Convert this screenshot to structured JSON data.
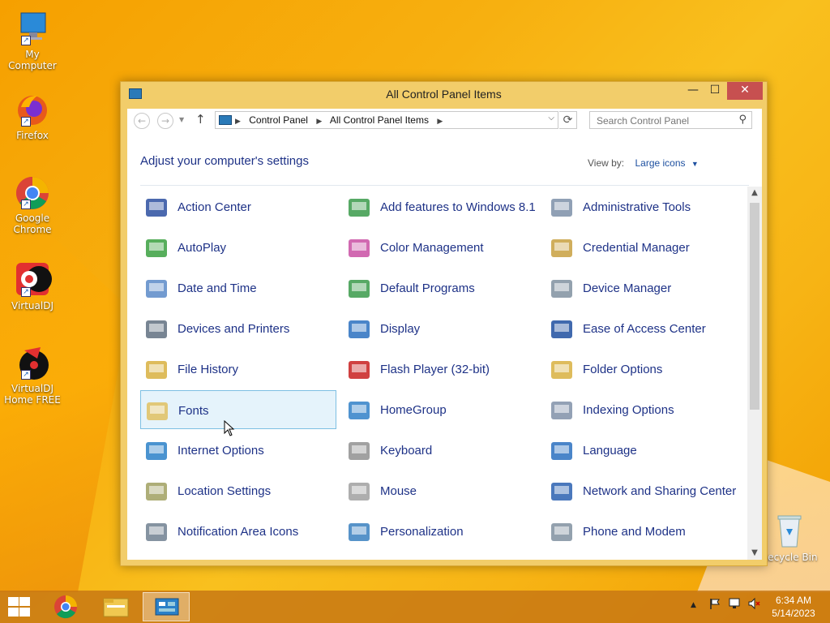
{
  "desktop": {
    "icons": [
      {
        "label": "My Computer",
        "name": "my-computer-icon"
      },
      {
        "label": "Firefox",
        "name": "firefox-icon"
      },
      {
        "label": "Google Chrome",
        "name": "chrome-icon"
      },
      {
        "label": "VirtualDJ",
        "name": "virtualdj-icon"
      },
      {
        "label": "VirtualDJ Home FREE",
        "name": "virtualdj-home-icon"
      },
      {
        "label": "Recycle Bin",
        "name": "recycle-bin-icon"
      }
    ]
  },
  "window": {
    "title": "All Control Panel Items",
    "minimize_glyph": "—",
    "maximize_glyph": "☐",
    "close_glyph": "✕",
    "address": {
      "crumbs": [
        "Control Panel",
        "All Control Panel Items"
      ],
      "sep": "▶"
    },
    "search": {
      "placeholder": "Search Control Panel"
    },
    "heading": "Adjust your computer's settings",
    "view_by_label": "View by:",
    "view_by_value": "Large icons",
    "items": [
      {
        "label": "Action Center",
        "color": "#2b4fa0"
      },
      {
        "label": "Add features to Windows 8.1",
        "color": "#3a9a4a"
      },
      {
        "label": "Administrative Tools",
        "color": "#7c8fa8"
      },
      {
        "label": "AutoPlay",
        "color": "#3aa040"
      },
      {
        "label": "Color Management",
        "color": "#c94fa3"
      },
      {
        "label": "Credential Manager",
        "color": "#c8a040"
      },
      {
        "label": "Date and Time",
        "color": "#5a8ac8"
      },
      {
        "label": "Default Programs",
        "color": "#3a9a4a"
      },
      {
        "label": "Device Manager",
        "color": "#8090a0"
      },
      {
        "label": "Devices and Printers",
        "color": "#607080"
      },
      {
        "label": "Display",
        "color": "#2a70c0"
      },
      {
        "label": "Ease of Access Center",
        "color": "#1e4fa0"
      },
      {
        "label": "File History",
        "color": "#d8b040"
      },
      {
        "label": "Flash Player (32-bit)",
        "color": "#c81e1e"
      },
      {
        "label": "Folder Options",
        "color": "#d8b040"
      },
      {
        "label": "Fonts",
        "color": "#e0c060"
      },
      {
        "label": "HomeGroup",
        "color": "#3080c8"
      },
      {
        "label": "Indexing Options",
        "color": "#8090a8"
      },
      {
        "label": "Internet Options",
        "color": "#2a80c8"
      },
      {
        "label": "Keyboard",
        "color": "#909090"
      },
      {
        "label": "Language",
        "color": "#2a70c0"
      },
      {
        "label": "Location Settings",
        "color": "#a0a060"
      },
      {
        "label": "Mouse",
        "color": "#a0a0a0"
      },
      {
        "label": "Network and Sharing Center",
        "color": "#2a60b0"
      },
      {
        "label": "Notification Area Icons",
        "color": "#708090"
      },
      {
        "label": "Personalization",
        "color": "#3a80c0"
      },
      {
        "label": "Phone and Modem",
        "color": "#8090a0"
      }
    ],
    "selected_item": "Fonts"
  },
  "taskbar": {
    "time": "6:34 AM",
    "date": "5/14/2023",
    "tray_up": "▲"
  }
}
